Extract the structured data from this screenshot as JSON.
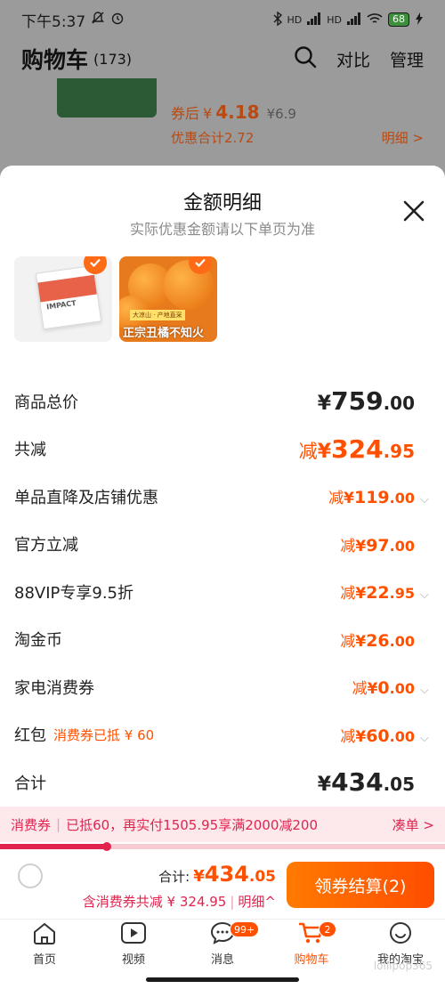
{
  "status_bar": {
    "time": "下午5:37",
    "signal_label_1": "HD",
    "signal_label_2": "HD",
    "battery": "68"
  },
  "cart_header": {
    "title": "购物车",
    "count": "(173)",
    "compare_label": "对比",
    "manage_label": "管理"
  },
  "bg_product": {
    "after_coupon_label": "券后",
    "price_yen": "¥",
    "price": "4.18",
    "original_price": "¥6.9",
    "discount_total": "优惠合计2.72",
    "detail_link": "明细 >"
  },
  "sheet": {
    "title": "金额明细",
    "subtitle": "实际优惠金额请以下单页为准",
    "thumbnails": [
      {
        "brand": "IMPACT"
      },
      {
        "tag": "大凉山 · 产地直采",
        "caption": "正宗丑橘不知火"
      }
    ],
    "rows": {
      "total_price": {
        "label": "商品总价",
        "yen": "¥",
        "int": "759",
        "dec": ".00"
      },
      "total_reduce": {
        "label": "共减",
        "prefix": "减",
        "yen": "¥",
        "int": "324",
        "dec": ".95"
      },
      "shop_discount": {
        "label": "单品直降及店铺优惠",
        "prefix": "减",
        "yen": "¥",
        "int": "119",
        "dec": ".00"
      },
      "official": {
        "label": "官方立减",
        "prefix": "减",
        "yen": "¥",
        "int": "97",
        "dec": ".00"
      },
      "vip": {
        "label": "88VIP专享9.5折",
        "prefix": "减",
        "yen": "¥",
        "int": "22",
        "dec": ".95"
      },
      "taojinbi": {
        "label": "淘金币",
        "prefix": "减",
        "yen": "¥",
        "int": "26",
        "dec": ".00"
      },
      "appliance_coupon": {
        "label": "家电消费券",
        "prefix": "减",
        "yen": "¥",
        "int": "0",
        "dec": ".00"
      },
      "hongbao": {
        "label": "红包",
        "note": "消费券已抵 ¥ 60",
        "prefix": "减",
        "yen": "¥",
        "int": "60",
        "dec": ".00"
      },
      "sum": {
        "label": "合计",
        "yen": "¥",
        "int": "434",
        "dec": ".05"
      }
    }
  },
  "coupon_bar": {
    "label": "消费券",
    "message": "已抵60，再实付1505.95享满2000减200",
    "action": "凑单 >",
    "progress_fraction": 0.24
  },
  "checkout": {
    "total_label": "合计:",
    "yen": "¥",
    "int": "434",
    "dec": ".05",
    "reduce_text": "含消费券共减 ¥ 324.95",
    "detail_label": "明细^",
    "settle_label": "领券结算(2)"
  },
  "tabbar": {
    "tabs": [
      {
        "label": "首页",
        "icon": "home-icon"
      },
      {
        "label": "视频",
        "icon": "video-icon"
      },
      {
        "label": "消息",
        "icon": "message-icon",
        "badge": "99+"
      },
      {
        "label": "购物车",
        "icon": "cart-icon",
        "badge": "2",
        "active": true
      },
      {
        "label": "我的淘宝",
        "icon": "profile-icon"
      }
    ]
  },
  "watermark": "lollipop365",
  "colors": {
    "accent": "#ff5000",
    "coupon_red": "#e0244e",
    "text": "#222222",
    "muted": "#8a8a8a"
  }
}
